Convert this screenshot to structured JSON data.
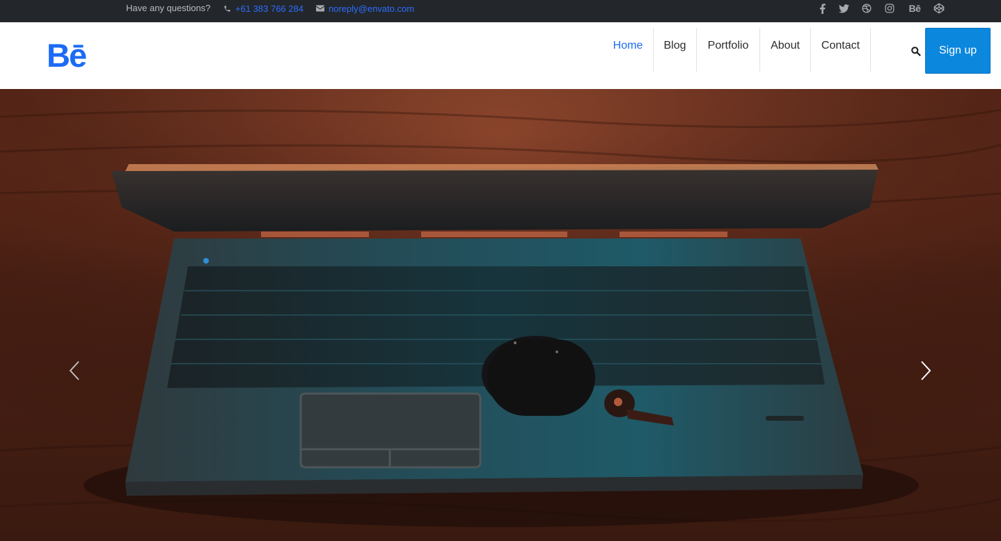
{
  "topbar": {
    "question": "Have any questions?",
    "phone": "+61 383 766 284",
    "email": "noreply@envato.com",
    "socials": [
      "facebook-icon",
      "twitter-icon",
      "dribbble-icon",
      "instagram-icon",
      "behance-icon",
      "codepen-icon"
    ],
    "behance_label": "Bē"
  },
  "header": {
    "logo": "Bē",
    "nav": [
      {
        "label": "Home",
        "active": true
      },
      {
        "label": "Blog",
        "active": false
      },
      {
        "label": "Portfolio",
        "active": false
      },
      {
        "label": "About",
        "active": false
      },
      {
        "label": "Contact",
        "active": false
      }
    ],
    "signup_label": "Sign up"
  },
  "hero": {
    "image": "laptop-with-earbuds-photo",
    "controls": [
      "prev-arrow-icon",
      "next-arrow-icon"
    ]
  },
  "colors": {
    "accent": "#1c6bf5",
    "signup": "#0b87de",
    "topbar": "#23272b"
  }
}
